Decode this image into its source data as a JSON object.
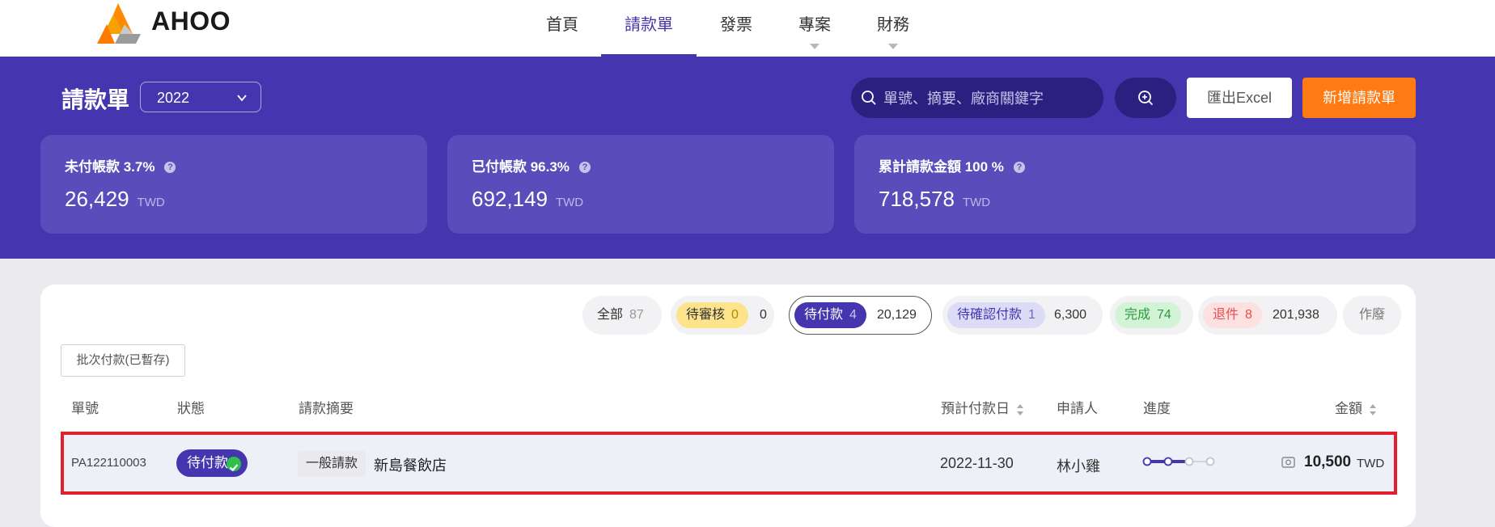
{
  "brand": {
    "name": "AHOO"
  },
  "nav": {
    "items": [
      {
        "label": "首頁",
        "active": false,
        "dropdown": false
      },
      {
        "label": "請款單",
        "active": true,
        "dropdown": false
      },
      {
        "label": "發票",
        "active": false,
        "dropdown": false
      },
      {
        "label": "專案",
        "active": false,
        "dropdown": true
      },
      {
        "label": "財務",
        "active": false,
        "dropdown": true
      }
    ]
  },
  "header": {
    "title": "請款單",
    "year": "2022",
    "search_placeholder": "單號、摘要、廠商關鍵字",
    "export_label": "匯出Excel",
    "new_label": "新增請款單"
  },
  "stats": [
    {
      "label": "未付帳款 3.7%",
      "amount": "26,429",
      "currency": "TWD"
    },
    {
      "label": "已付帳款 96.3%",
      "amount": "692,149",
      "currency": "TWD"
    },
    {
      "label": "累計請款金額 100 %",
      "amount": "718,578",
      "currency": "TWD"
    }
  ],
  "filters": {
    "all": {
      "label": "全部",
      "count": "87"
    },
    "review": {
      "label": "待審核",
      "count": "0",
      "amount": "0"
    },
    "pay": {
      "label": "待付款",
      "count": "4",
      "amount": "20,129"
    },
    "confirm": {
      "label": "待確認付款",
      "count": "1",
      "amount": "6,300"
    },
    "done": {
      "label": "完成",
      "count": "74"
    },
    "returned": {
      "label": "退件",
      "count": "8",
      "amount": "201,938"
    },
    "void": {
      "label": "作廢"
    }
  },
  "batch_label": "批次付款(已暫存)",
  "table": {
    "headers": {
      "number": "單號",
      "status": "狀態",
      "summary": "請款摘要",
      "due": "預計付款日",
      "applicant": "申請人",
      "progress": "進度",
      "amount": "金額"
    },
    "rows": [
      {
        "number": "PA122110003",
        "status": "待付款",
        "type": "一般請款",
        "summary": "新島餐飲店",
        "due": "2022-11-30",
        "applicant": "林小雞",
        "progress_step": 2,
        "progress_total": 4,
        "amount": "10,500",
        "currency": "TWD"
      }
    ]
  },
  "colors": {
    "primary": "#4536b0",
    "accent": "#ff7a12",
    "highlight_border": "#e0202c"
  }
}
